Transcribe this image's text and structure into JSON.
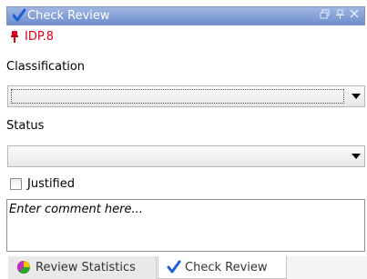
{
  "window": {
    "title": "Check Review",
    "restore_icon": "restore-icon",
    "pin_icon": "pin-icon",
    "close_icon": "close-icon"
  },
  "requirement": {
    "id": "IDP.8",
    "icon": "red-pin-icon",
    "color": "#e0001a"
  },
  "classification": {
    "label": "Classification",
    "value": ""
  },
  "status": {
    "label": "Status",
    "value": ""
  },
  "justified": {
    "label": "Justified",
    "checked": false
  },
  "comment": {
    "placeholder": "Enter comment here..."
  },
  "tabs": [
    {
      "label": "Review Statistics",
      "icon": "review-statistics-icon",
      "active": false
    },
    {
      "label": "Check Review",
      "icon": "checkmark-icon",
      "active": true
    }
  ],
  "colors": {
    "titlebar": "#6f8fcf",
    "accent_check": "#1f5fd6"
  }
}
